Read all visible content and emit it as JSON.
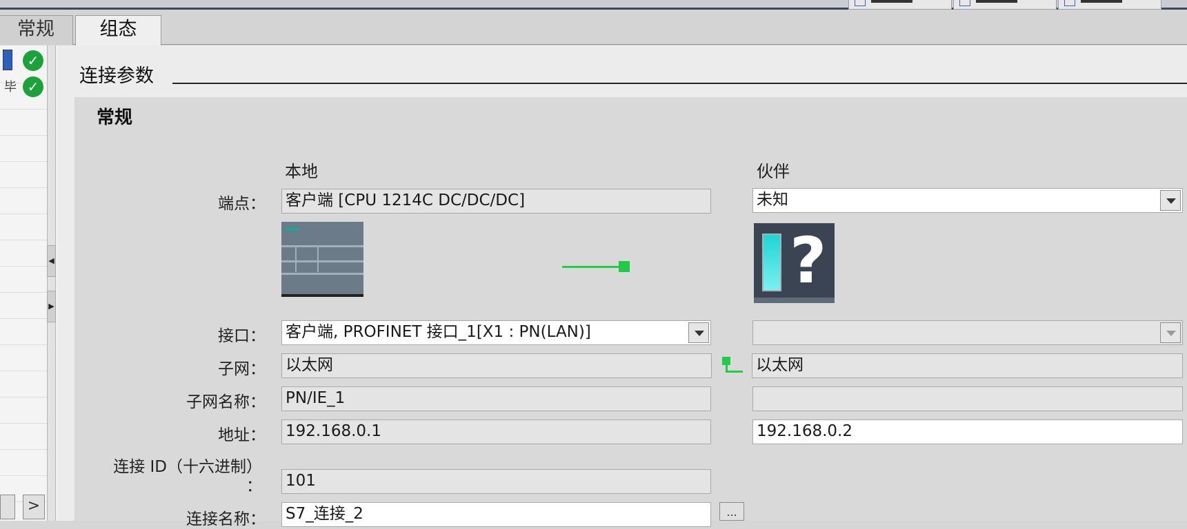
{
  "tabs": [
    "常规",
    "组态"
  ],
  "active_tab": "组态",
  "nav": {
    "item2_label": "毕",
    "splitter_left": "◀",
    "splitter_right": "▶",
    "scroll_next": ">"
  },
  "section": {
    "title": "连接参数",
    "subtitle": "常规"
  },
  "columns": {
    "local": "本地",
    "partner": "伙伴"
  },
  "rows": {
    "endpoint": {
      "label": "端点：",
      "local": "客户端 [CPU 1214C DC/DC/DC]",
      "partner": "未知"
    },
    "interface": {
      "label": "接口：",
      "local": "客户端, PROFINET 接口_1[X1 : PN(LAN)]",
      "partner": ""
    },
    "subnet": {
      "label": "子网：",
      "local": "以太网",
      "partner": "以太网"
    },
    "subnet_name": {
      "label": "子网名称：",
      "local": "PN/IE_1",
      "partner": ""
    },
    "address": {
      "label": "地址：",
      "local": "192.168.0.1",
      "partner": "192.168.0.2"
    },
    "connection_id": {
      "label_line1": "连接 ID（十六进制）",
      "label_line2": "：",
      "local": "101"
    },
    "connection_name": {
      "label": "连接名称：",
      "local": "S7_连接_2",
      "browse": "..."
    }
  },
  "icons": [
    "check-icon",
    "dropdown-arrow-icon",
    "cpu-device-icon",
    "unknown-device-icon",
    "connection-line-icon",
    "subnet-connector-icon"
  ],
  "colors": {
    "ok_green": "#1ba23b",
    "link_green": "#1fcc43",
    "accent_blue": "#2f5fb8"
  }
}
